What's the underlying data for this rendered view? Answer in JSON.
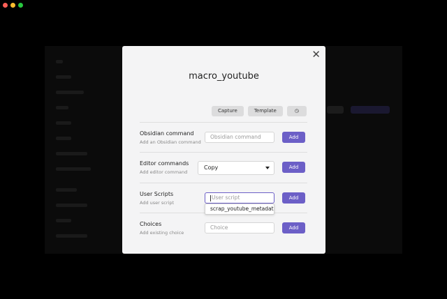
{
  "modal": {
    "title": "macro_youtube",
    "close_glyph": "✕",
    "tabs": [
      {
        "label": "Capture"
      },
      {
        "label": "Template"
      },
      {
        "label": "◷",
        "icon": "clock-icon"
      }
    ]
  },
  "commands": [
    {
      "label": "Obsidian command",
      "desc": "Add an Obsidian command",
      "placeholder": "Obsidian command",
      "button": "Add"
    },
    {
      "label": "Editor commands",
      "desc": "Add editor command",
      "selected": "Copy",
      "button": "Add"
    },
    {
      "label": "User Scripts",
      "desc": "Add user script",
      "placeholder": "User script",
      "button": "Add"
    },
    {
      "label": "Choices",
      "desc": "Add existing choice",
      "placeholder": "Choice",
      "button": "Add"
    }
  ],
  "suggestion": {
    "text": "scrap_youtube_metadata"
  },
  "colors": {
    "accent": "#6c5fc7",
    "modal_bg": "#f4f4f5"
  }
}
